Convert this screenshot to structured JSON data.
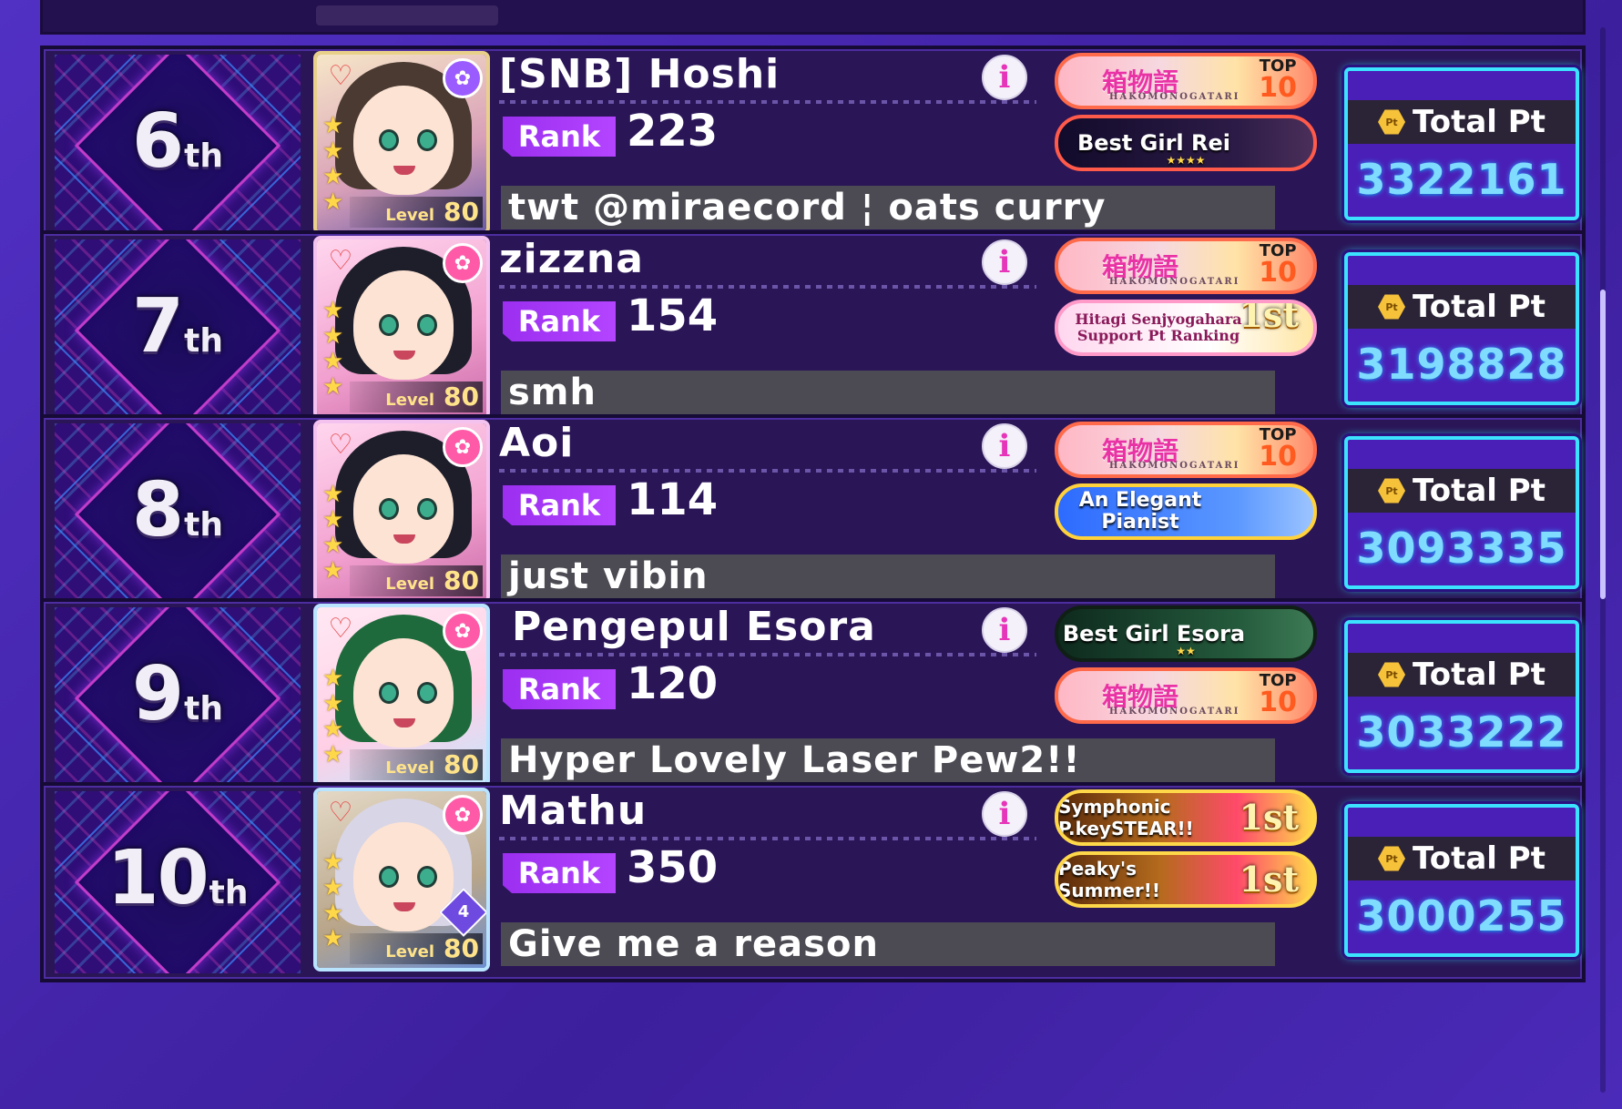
{
  "entries": [
    {
      "rank_num": "6",
      "rank_suffix": "th",
      "name": "[SNB] Hoshi",
      "rank_label": "Rank",
      "rank_value": "223",
      "comment": "twt @miraecord ¦ oats curry",
      "level_label": "Level",
      "level": "80",
      "badges": [
        {
          "type": "top10",
          "text": "箱物語",
          "sub": "HAKOMONOGATARI",
          "top": "TOP",
          "num": "10"
        },
        {
          "type": "dark",
          "text": "Best Girl Rei",
          "stars": "★★★★"
        }
      ],
      "pt_label": "Total Pt",
      "pt_value": "3322161"
    },
    {
      "rank_num": "7",
      "rank_suffix": "th",
      "name": "zizzna",
      "rank_label": "Rank",
      "rank_value": "154",
      "comment": "smh",
      "level_label": "Level",
      "level": "80",
      "badges": [
        {
          "type": "top10",
          "text": "箱物語",
          "sub": "HAKOMONOGATARI",
          "top": "TOP",
          "num": "10"
        },
        {
          "type": "pinkwhite",
          "text": "Hitagi Senjyogahara",
          "sub": "Support Pt Ranking",
          "first": "1st"
        }
      ],
      "pt_label": "Total Pt",
      "pt_value": "3198828"
    },
    {
      "rank_num": "8",
      "rank_suffix": "th",
      "name": "Aoi",
      "rank_label": "Rank",
      "rank_value": "114",
      "comment": "just vibin",
      "level_label": "Level",
      "level": "80",
      "badges": [
        {
          "type": "top10",
          "text": "箱物語",
          "sub": "HAKOMONOGATARI",
          "top": "TOP",
          "num": "10"
        },
        {
          "type": "blue",
          "text": "An Elegant",
          "text2": "Pianist"
        }
      ],
      "pt_label": "Total Pt",
      "pt_value": "3093335"
    },
    {
      "rank_num": "9",
      "rank_suffix": "th",
      "name": "Pengepul Esora",
      "rank_label": "Rank",
      "rank_value": "120",
      "comment": "Hyper Lovely Laser Pew2!!",
      "level_label": "Level",
      "level": "80",
      "badges": [
        {
          "type": "green",
          "text": "Best Girl Esora",
          "stars": "★★"
        },
        {
          "type": "top10",
          "text": "箱物語",
          "sub": "HAKOMONOGATARI",
          "top": "TOP",
          "num": "10"
        }
      ],
      "pt_label": "Total Pt",
      "pt_value": "3033222"
    },
    {
      "rank_num": "10",
      "rank_suffix": "th",
      "name": "Mathu",
      "rank_label": "Rank",
      "rank_value": "350",
      "comment": "Give me a reason",
      "level_label": "Level",
      "level": "80",
      "master_rank": "4",
      "badges": [
        {
          "type": "gold",
          "text": "Symphonic P.keySTEAR!!",
          "first": "1st"
        },
        {
          "type": "gold",
          "text": "Peaky's Summer!!",
          "first": "1st"
        }
      ],
      "pt_label": "Total Pt",
      "pt_value": "3000255"
    }
  ],
  "icons": {
    "info": "i",
    "pt_coin": "Pt",
    "attr_cool": "heart-ribbon-icon",
    "attr_happy": "ribbon-icon",
    "star": "★"
  },
  "colors": {
    "accent_purple": "#9b2ef0",
    "pt_border": "#3ce3ff",
    "pt_value": "#7fdcff",
    "row_bg": "#2a1557"
  }
}
